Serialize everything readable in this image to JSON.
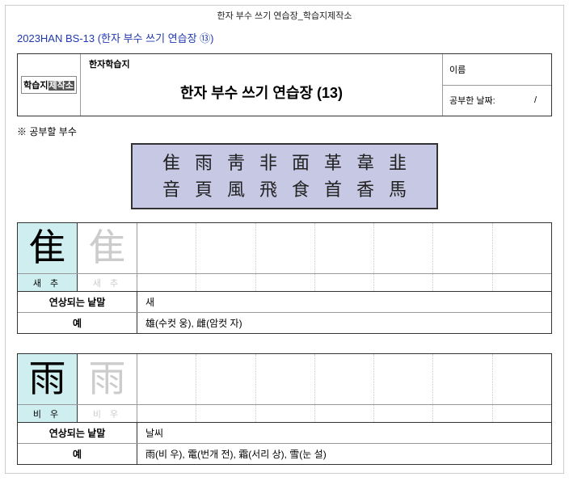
{
  "top_title": "한자 부수 쓰기 연습장_학습지제작소",
  "code_line": "2023HAN BS-13 (한자 부수 쓰기 연습장 ⑬)",
  "logo_parts": {
    "a": "학습지",
    "b": "제작소"
  },
  "header": {
    "small_label": "한자학습지",
    "main_title": "한자 부수 쓰기 연습장 (13)",
    "name_label": "이름",
    "date_label": "공부한 날짜:",
    "date_sep": "/"
  },
  "study_label": "※ 공부할 부수",
  "radicals": {
    "row1": "隹雨靑非面革韋韭",
    "row2": "音頁風飛食首香馬"
  },
  "labels": {
    "assoc": "연상되는 낱말",
    "example": "예"
  },
  "blocks": [
    {
      "char": "隹",
      "reading": "새 추",
      "assoc": "새",
      "example": "雄(수컷 웅), 雌(암컷 자)"
    },
    {
      "char": "雨",
      "reading": "비 우",
      "assoc": "날씨",
      "example": "雨(비 우), 電(번개 전), 霜(서리 상), 雪(눈 설)"
    }
  ]
}
